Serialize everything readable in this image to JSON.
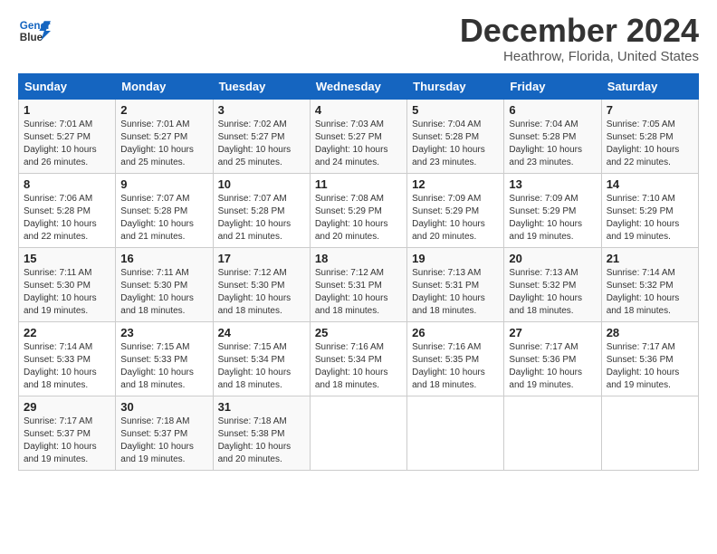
{
  "logo": {
    "line1": "General",
    "line2": "Blue"
  },
  "title": "December 2024",
  "location": "Heathrow, Florida, United States",
  "days_of_week": [
    "Sunday",
    "Monday",
    "Tuesday",
    "Wednesday",
    "Thursday",
    "Friday",
    "Saturday"
  ],
  "weeks": [
    [
      {
        "day": "1",
        "sunrise": "7:01 AM",
        "sunset": "5:27 PM",
        "daylight": "10 hours and 26 minutes."
      },
      {
        "day": "2",
        "sunrise": "7:01 AM",
        "sunset": "5:27 PM",
        "daylight": "10 hours and 25 minutes."
      },
      {
        "day": "3",
        "sunrise": "7:02 AM",
        "sunset": "5:27 PM",
        "daylight": "10 hours and 25 minutes."
      },
      {
        "day": "4",
        "sunrise": "7:03 AM",
        "sunset": "5:27 PM",
        "daylight": "10 hours and 24 minutes."
      },
      {
        "day": "5",
        "sunrise": "7:04 AM",
        "sunset": "5:28 PM",
        "daylight": "10 hours and 23 minutes."
      },
      {
        "day": "6",
        "sunrise": "7:04 AM",
        "sunset": "5:28 PM",
        "daylight": "10 hours and 23 minutes."
      },
      {
        "day": "7",
        "sunrise": "7:05 AM",
        "sunset": "5:28 PM",
        "daylight": "10 hours and 22 minutes."
      }
    ],
    [
      {
        "day": "8",
        "sunrise": "7:06 AM",
        "sunset": "5:28 PM",
        "daylight": "10 hours and 22 minutes."
      },
      {
        "day": "9",
        "sunrise": "7:07 AM",
        "sunset": "5:28 PM",
        "daylight": "10 hours and 21 minutes."
      },
      {
        "day": "10",
        "sunrise": "7:07 AM",
        "sunset": "5:28 PM",
        "daylight": "10 hours and 21 minutes."
      },
      {
        "day": "11",
        "sunrise": "7:08 AM",
        "sunset": "5:29 PM",
        "daylight": "10 hours and 20 minutes."
      },
      {
        "day": "12",
        "sunrise": "7:09 AM",
        "sunset": "5:29 PM",
        "daylight": "10 hours and 20 minutes."
      },
      {
        "day": "13",
        "sunrise": "7:09 AM",
        "sunset": "5:29 PM",
        "daylight": "10 hours and 19 minutes."
      },
      {
        "day": "14",
        "sunrise": "7:10 AM",
        "sunset": "5:29 PM",
        "daylight": "10 hours and 19 minutes."
      }
    ],
    [
      {
        "day": "15",
        "sunrise": "7:11 AM",
        "sunset": "5:30 PM",
        "daylight": "10 hours and 19 minutes."
      },
      {
        "day": "16",
        "sunrise": "7:11 AM",
        "sunset": "5:30 PM",
        "daylight": "10 hours and 18 minutes."
      },
      {
        "day": "17",
        "sunrise": "7:12 AM",
        "sunset": "5:30 PM",
        "daylight": "10 hours and 18 minutes."
      },
      {
        "day": "18",
        "sunrise": "7:12 AM",
        "sunset": "5:31 PM",
        "daylight": "10 hours and 18 minutes."
      },
      {
        "day": "19",
        "sunrise": "7:13 AM",
        "sunset": "5:31 PM",
        "daylight": "10 hours and 18 minutes."
      },
      {
        "day": "20",
        "sunrise": "7:13 AM",
        "sunset": "5:32 PM",
        "daylight": "10 hours and 18 minutes."
      },
      {
        "day": "21",
        "sunrise": "7:14 AM",
        "sunset": "5:32 PM",
        "daylight": "10 hours and 18 minutes."
      }
    ],
    [
      {
        "day": "22",
        "sunrise": "7:14 AM",
        "sunset": "5:33 PM",
        "daylight": "10 hours and 18 minutes."
      },
      {
        "day": "23",
        "sunrise": "7:15 AM",
        "sunset": "5:33 PM",
        "daylight": "10 hours and 18 minutes."
      },
      {
        "day": "24",
        "sunrise": "7:15 AM",
        "sunset": "5:34 PM",
        "daylight": "10 hours and 18 minutes."
      },
      {
        "day": "25",
        "sunrise": "7:16 AM",
        "sunset": "5:34 PM",
        "daylight": "10 hours and 18 minutes."
      },
      {
        "day": "26",
        "sunrise": "7:16 AM",
        "sunset": "5:35 PM",
        "daylight": "10 hours and 18 minutes."
      },
      {
        "day": "27",
        "sunrise": "7:17 AM",
        "sunset": "5:36 PM",
        "daylight": "10 hours and 19 minutes."
      },
      {
        "day": "28",
        "sunrise": "7:17 AM",
        "sunset": "5:36 PM",
        "daylight": "10 hours and 19 minutes."
      }
    ],
    [
      {
        "day": "29",
        "sunrise": "7:17 AM",
        "sunset": "5:37 PM",
        "daylight": "10 hours and 19 minutes."
      },
      {
        "day": "30",
        "sunrise": "7:18 AM",
        "sunset": "5:37 PM",
        "daylight": "10 hours and 19 minutes."
      },
      {
        "day": "31",
        "sunrise": "7:18 AM",
        "sunset": "5:38 PM",
        "daylight": "10 hours and 20 minutes."
      },
      null,
      null,
      null,
      null
    ]
  ]
}
